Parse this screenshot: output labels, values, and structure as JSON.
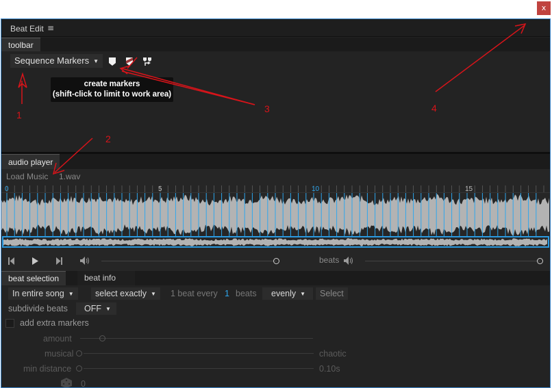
{
  "window": {
    "close_label": "x"
  },
  "panel": {
    "title": "Beat Edit",
    "menu_icon": "≡"
  },
  "toolbar_section": {
    "tab_label": "toolbar",
    "marker_type": "Sequence Markers",
    "tooltip_line1": "create markers",
    "tooltip_line2": "(shift-click to limit to work area)",
    "icons": [
      "marker-icon",
      "marker-shield-icon",
      "marker-arrows-icon"
    ]
  },
  "audio_section": {
    "tab_label": "audio player",
    "load_music_label": "Load Music",
    "file_name": "1.wav",
    "ruler_labels": [
      "0",
      "5",
      "10",
      "15"
    ],
    "beats_label": "beats",
    "volume_level": 1.0,
    "beats_volume_level": 1.0,
    "colors": {
      "waveform": "#b3b3b3",
      "beat_line": "#2ea7ee"
    }
  },
  "beat_section": {
    "tabs": [
      "beat selection",
      "beat info"
    ],
    "range": "In entire song",
    "select_mode": "select exactly",
    "beat_every_label": "1 beat every",
    "beat_every_value": "1",
    "beats_unit": "beats",
    "distribution": "evenly",
    "select_button": "Select",
    "subdivide_label": "subdivide beats",
    "subdivide_value": "OFF",
    "extra_markers_label": "add extra markers",
    "amount_label": "amount",
    "musical_label": "musical",
    "chaotic_label": "chaotic",
    "min_distance_label": "min distance",
    "min_distance_value": "0.10s",
    "dice_value": "0"
  },
  "annotations": {
    "labels": [
      "1",
      "2",
      "3",
      "4"
    ],
    "color": "#d8141a"
  }
}
